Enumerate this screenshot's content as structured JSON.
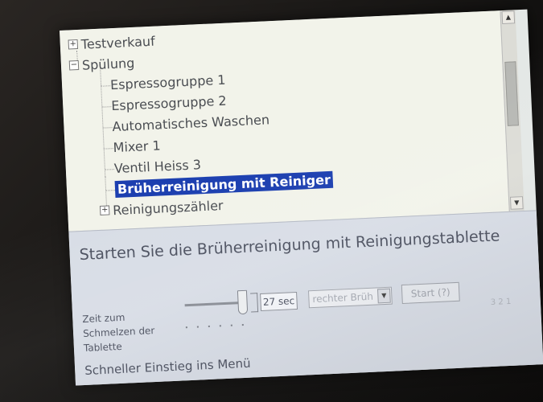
{
  "tree": {
    "items": [
      {
        "label": "Testverkauf",
        "expander": "+"
      },
      {
        "label": "Spülung",
        "expander": "−"
      },
      {
        "label": "Espressogruppe 1"
      },
      {
        "label": "Espressogruppe 2"
      },
      {
        "label": "Automatisches Waschen"
      },
      {
        "label": "Mixer 1"
      },
      {
        "label": "Ventil Heiss 3"
      },
      {
        "label": "Brüherreinigung mit Reiniger",
        "selected": true
      },
      {
        "label": "Reinigungszähler",
        "expander": "+"
      }
    ]
  },
  "scrollbar": {
    "up_icon": "▲",
    "down_icon": "▼"
  },
  "info": {
    "description": "Starten Sie die Brüherreinigung mit Reinigungstablette"
  },
  "controls": {
    "zeit_label": "Zeit zum Schmelzen der Tablette",
    "duration_value": "27 sec",
    "select_value": "rechter Brüh",
    "select_arrow": "▼",
    "start_label": "Start (?)",
    "faint_number": "3 2 1"
  },
  "footer": {
    "quick_menu_label": "Schneller Einstieg ins Menü"
  }
}
